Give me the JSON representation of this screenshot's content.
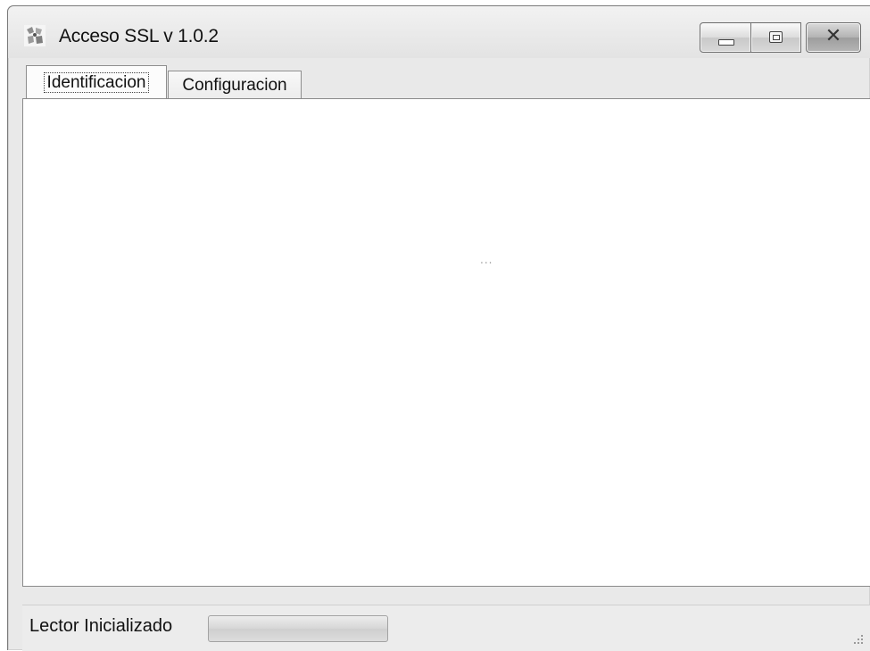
{
  "window": {
    "title": "Acceso SSL v 1.0.2",
    "app_icon": "shield-figures-icon",
    "caption_buttons": {
      "minimize": "minimize-icon",
      "maximize": "maximize-icon",
      "close_glyph": "✕"
    }
  },
  "tabs": [
    {
      "label": "Identificacion",
      "selected": true
    },
    {
      "label": "Configuracion",
      "selected": false
    }
  ],
  "main": {
    "placeholder": "..."
  },
  "status_bar": {
    "text": "Lector Inicializado",
    "progress": 0
  }
}
